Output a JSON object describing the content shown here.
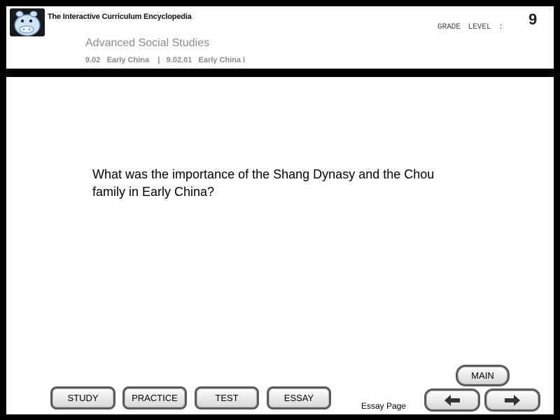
{
  "header": {
    "app_title": "The Interactive Curriculum Encyclopedia",
    "course_title": "Advanced Social Studies",
    "breadcrumb": {
      "unit_code": "9.02",
      "unit_name": "Early China",
      "separator": "|",
      "lesson_code": "9.02.01",
      "lesson_name": "Early China I"
    },
    "grade_label": "GRADE LEVEL :",
    "grade_value": "9"
  },
  "content": {
    "question": "What was the importance of the Shang Dynasy and the Chou family in Early China?"
  },
  "footer": {
    "nav_buttons": [
      "STUDY",
      "PRACTICE",
      "TEST",
      "ESSAY"
    ],
    "main_label": "MAIN",
    "page_label": "Essay Page",
    "back_icon": "arrow-left-icon",
    "forward_icon": "arrow-right-icon"
  },
  "colors": {
    "frame": "#000000",
    "panel": "#ffffff",
    "muted_text": "#8a8a8a",
    "button_border": "#5a5a5a"
  }
}
